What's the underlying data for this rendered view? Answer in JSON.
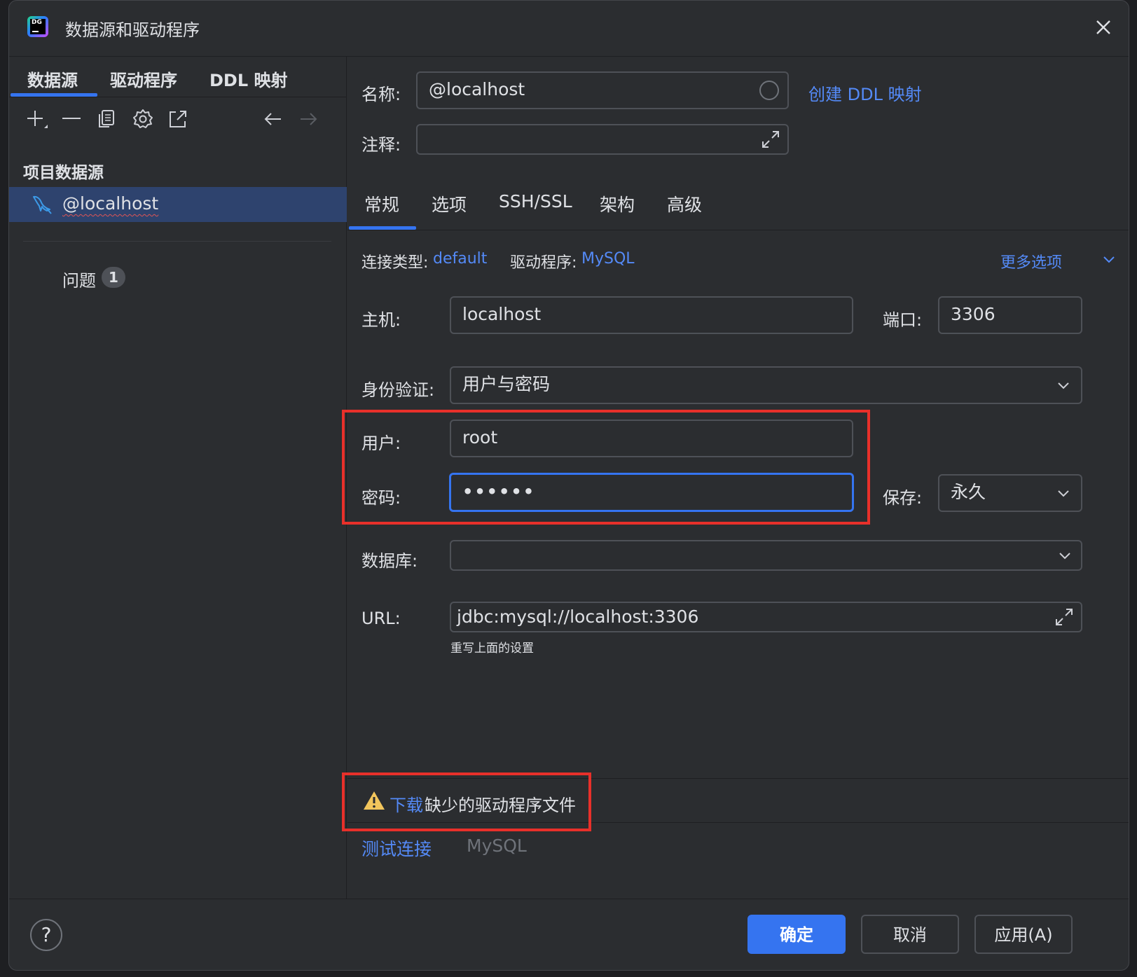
{
  "window": {
    "title": "数据源和驱动程序"
  },
  "left": {
    "tabs": [
      {
        "label": "数据源"
      },
      {
        "label": "驱动程序"
      },
      {
        "label": "DDL 映射"
      }
    ],
    "section_title": "项目数据源",
    "datasource": {
      "label": "@localhost"
    },
    "problems": {
      "label": "问题",
      "count": "1"
    }
  },
  "form": {
    "name_label": "名称:",
    "name_value": "@localhost",
    "create_ddl_link": "创建 DDL 映射",
    "comment_label": "注释:",
    "comment_value": ""
  },
  "tabs": [
    {
      "label": "常规"
    },
    {
      "label": "选项"
    },
    {
      "label": "SSH/SSL"
    },
    {
      "label": "架构"
    },
    {
      "label": "高级"
    }
  ],
  "general": {
    "conn_type_label": "连接类型:",
    "conn_type_value": "default",
    "driver_label": "驱动程序:",
    "driver_value": "MySQL",
    "more_options": "更多选项",
    "host_label": "主机:",
    "host_value": "localhost",
    "port_label": "端口:",
    "port_value": "3306",
    "auth_label": "身份验证:",
    "auth_value": "用户与密码",
    "user_label": "用户:",
    "user_value": "root",
    "password_label": "密码:",
    "password_value": "••••••",
    "save_label": "保存:",
    "save_value": "永久",
    "database_label": "数据库:",
    "database_value": "",
    "url_label": "URL:",
    "url_value": "jdbc:mysql://localhost:3306",
    "url_hint": "重写上面的设置"
  },
  "warning": {
    "link": "下载",
    "text": "缺少的驱动程序文件"
  },
  "test": {
    "link": "测试连接",
    "driver": "MySQL"
  },
  "footer": {
    "help": "?",
    "ok": "确定",
    "cancel": "取消",
    "apply": "应用(A)"
  },
  "colors": {
    "accent": "#3574f0",
    "link": "#548af7",
    "annotation": "#e8302a",
    "warning": "#f2c55c"
  }
}
